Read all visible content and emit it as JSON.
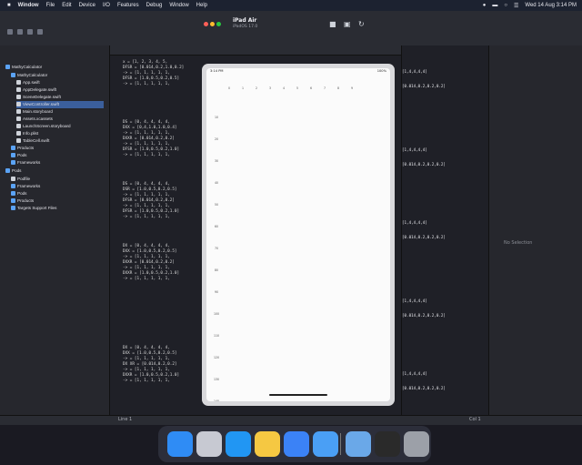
{
  "menubar": {
    "apple": "",
    "items": [
      "Window",
      "File",
      "Edit",
      "Device",
      "I/O",
      "Features",
      "Debug",
      "Window",
      "Help"
    ],
    "clock": "Wed 14 Aug 3:14 PM"
  },
  "simulator": {
    "device_name": "iPad Air",
    "os_version": "iPadOS 17.0",
    "status_time": "3:14 PM",
    "status_right": "100%",
    "header": [
      "",
      "0",
      "1",
      "2",
      "3",
      "4",
      "5",
      "6",
      "7",
      "8",
      "9"
    ],
    "rows": [
      "10",
      "20",
      "30",
      "40",
      "50",
      "60",
      "70",
      "80",
      "90",
      "100",
      "110",
      "120",
      "130",
      "140"
    ]
  },
  "navigator": {
    "items": [
      {
        "label": "MathyCalculator",
        "icon": "project-icon"
      },
      {
        "label": "MathyCalculator",
        "icon": "folder-icon"
      },
      {
        "label": "App.swift",
        "icon": "swift-file-icon"
      },
      {
        "label": "AppDelegate.swift",
        "icon": "swift-file-icon"
      },
      {
        "label": "SceneDelegate.swift",
        "icon": "swift-file-icon"
      },
      {
        "label": "ViewController.swift",
        "icon": "swift-file-icon"
      },
      {
        "label": "Main.storyboard",
        "icon": "storyboard-icon"
      },
      {
        "label": "Assets.xcassets",
        "icon": "assets-icon"
      },
      {
        "label": "LaunchScreen.storyboard",
        "icon": "storyboard-icon"
      },
      {
        "label": "Info.plist",
        "icon": "plist-icon"
      },
      {
        "label": "TableCell.swift",
        "icon": "swift-file-icon"
      },
      {
        "label": "Products",
        "icon": "folder-icon"
      },
      {
        "label": "Pods",
        "icon": "folder-icon"
      },
      {
        "label": "Frameworks",
        "icon": "folder-icon"
      },
      {
        "label": "Pods",
        "icon": "project-icon"
      },
      {
        "label": "Podfile",
        "icon": "file-icon"
      },
      {
        "label": "Frameworks",
        "icon": "folder-icon"
      },
      {
        "label": "Pods",
        "icon": "folder-icon"
      },
      {
        "label": "Products",
        "icon": "folder-icon"
      },
      {
        "label": "Targets Support Files",
        "icon": "folder-icon"
      }
    ]
  },
  "editor": {
    "code_blocks": [
      [
        "x = [1, 2, 3, 4, 5,",
        "DFSR = [0.014,0.2,1.0,0.2]",
        "-> = [1, 1, 1, 1, 1,",
        "DFSR = [1.0,0.5,0.2,0.5]",
        "-> = [1, 1, 1, 1, 1,"
      ],
      [
        "DS = [0, 4, 4, 4, 4,",
        "DXX = [0,4,1.0,1.0,0.4]",
        "-> = [1, 1, 1, 1, 1,",
        "DXXR = [0.014,0.2,0.2]",
        "-> = [1, 1, 1, 1, 1,",
        "DFSR = [1.0,0.5,0.2,1.0]",
        "-> = [1, 1, 1, 1, 1,"
      ],
      [
        "DS = [0, 4, 4, 4, 4,",
        "DSR = [1.0,0.5,0.2,0.5]",
        "-> = [1, 1, 1, 1, 1,",
        "DFSR = [0.014,0.2,0.2]",
        "-> = [1, 1, 1, 1, 1,",
        "DFSR = [1.0,0.5,0.2,1.0]",
        "-> = [1, 1, 1, 1, 1,"
      ],
      [
        "DX = [0, 4, 4, 4, 4,",
        "DXX = [1.0,0.5,0.2,0.5]",
        "-> = [1, 1, 1, 1, 1,",
        "DXXR = [0.014,0.2,0.2]",
        "-> = [1, 1, 1, 1, 1,",
        "DXXR = [1.0,0.5,0.2,1.0]",
        "-> = [1, 1, 1, 1, 1,"
      ],
      [
        "DX = [0, 4, 4, 4, 4,",
        "DXX = [1.0,0.5,0.2,0.5]",
        "-> = [1, 1, 1, 1, 1,",
        "DX XR = [0.014,0.2,0.2]",
        "-> = [1, 1, 1, 1, 1,",
        "DXXR = [1.0,0.5,0.2,1.0]",
        "-> = [1, 1, 1, 1, 1,"
      ]
    ],
    "status_left": "Line 1",
    "status_right": "Col 1"
  },
  "results": {
    "items": [
      "[1,4,4,4,4]",
      "[0.014,0.2,0.2,0.2]",
      "[1,4,4,4,4]",
      "[0.014,0.2,0.2,0.2]",
      "[1,4,4,4,4]",
      "[0.014,0.2,0.2,0.2]",
      "[1,4,4,4,4]",
      "[0.014,0.2,0.2,0.2]",
      "[1,4,4,4,4]",
      "[0.014,0.2,0.2,0.2]"
    ]
  },
  "inspector": {
    "no_selection": "No Selection"
  },
  "dock": {
    "apps": [
      "finder-icon",
      "launchpad-icon",
      "safari-icon",
      "notes-icon",
      "simulator-app-icon",
      "xcode-icon",
      "preview-icon",
      "terminal-icon",
      "trash-icon"
    ]
  },
  "colors": {
    "accent": "#3b5f9c",
    "menubar": "#1c2230",
    "sidebar": "#26272d"
  }
}
